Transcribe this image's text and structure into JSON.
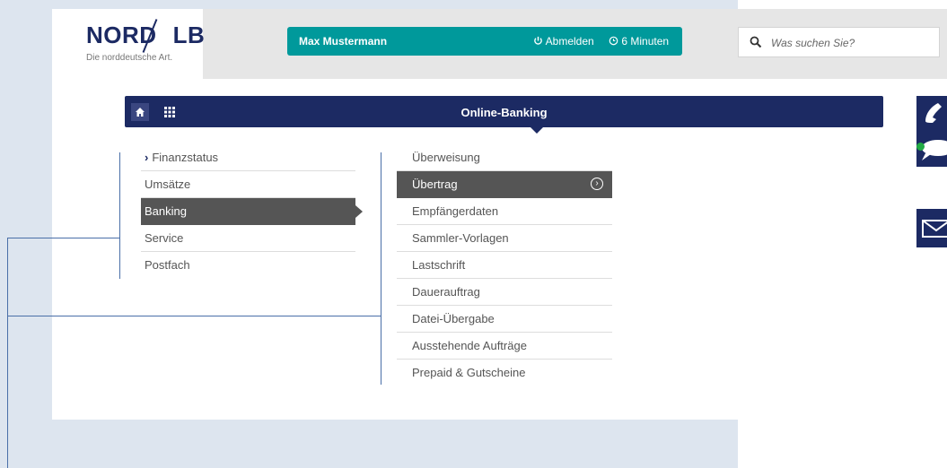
{
  "header": {
    "logo_main_left": "NORD",
    "logo_main_right": "LB",
    "logo_tagline": "Die norddeutsche Art."
  },
  "userbar": {
    "user_name": "Max Mustermann",
    "logout_label": "Abmelden",
    "session_timer": "6 Minuten"
  },
  "search": {
    "placeholder": "Was suchen Sie?"
  },
  "nav": {
    "title": "Online-Banking"
  },
  "menu_level1": {
    "items": [
      {
        "label": "Finanzstatus"
      },
      {
        "label": "Umsätze"
      },
      {
        "label": "Banking"
      },
      {
        "label": "Service"
      },
      {
        "label": "Postfach"
      }
    ]
  },
  "menu_level2": {
    "items": [
      {
        "label": "Überweisung"
      },
      {
        "label": "Übertrag"
      },
      {
        "label": "Empfängerdaten"
      },
      {
        "label": "Sammler-Vorlagen"
      },
      {
        "label": "Lastschrift"
      },
      {
        "label": "Dauerauftrag"
      },
      {
        "label": "Datei-Übergabe"
      },
      {
        "label": "Ausstehende Aufträge"
      },
      {
        "label": "Prepaid & Gutscheine"
      }
    ]
  },
  "colors": {
    "brand_navy": "#1c2a63",
    "teal": "#00999b",
    "active_gray": "#555555",
    "annotation_blue": "#4a6fa8",
    "status_green": "#22aa44"
  },
  "icons": {
    "home": "home-icon",
    "apps": "grid-icon",
    "power": "power-icon",
    "clock": "clock-icon",
    "search": "search-icon",
    "phone": "phone-icon",
    "chat": "chat-icon",
    "mail": "mail-icon"
  }
}
